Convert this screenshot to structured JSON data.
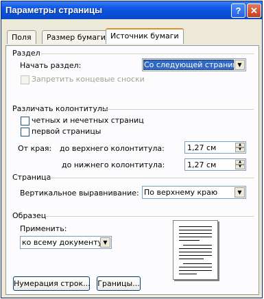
{
  "window": {
    "title": "Параметры страницы",
    "help_label": "?",
    "close_label": "✕"
  },
  "tabs": [
    {
      "label": "Поля",
      "active": false
    },
    {
      "label": "Размер бумаги",
      "active": false
    },
    {
      "label": "Источник бумаги",
      "active": true
    }
  ],
  "section": {
    "heading": "Раздел",
    "start_label": "Начать раздел:",
    "start_value": "Со следующей страницы",
    "suppress_endnotes": "Запретить концевые сноски"
  },
  "headers": {
    "heading": "Различать колонтитулы",
    "odd_even": "четных и нечетных страниц",
    "first_page": "первой страницы",
    "from_edge": "От края:",
    "header_label": "до верхнего колонтитула:",
    "header_value": "1,27 см",
    "footer_label": "до нижнего колонтитула:",
    "footer_value": "1,27 см"
  },
  "page": {
    "heading": "Страница",
    "valign_label": "Вертикальное выравнивание:",
    "valign_value": "По верхнему краю"
  },
  "preview": {
    "heading": "Образец",
    "apply_label": "Применить:",
    "apply_value": "ко всему документу"
  },
  "buttons": {
    "line_numbers": "Нумерация строк...",
    "borders": "Границы..."
  },
  "icons": {
    "dropdown": "▼",
    "spin_up": "▲",
    "spin_down": "▼"
  },
  "colors": {
    "titlebar": "#0a4fd6",
    "dialog": "#ece9d8",
    "tab_highlight": "#e68b2c",
    "selection": "#316ac5"
  }
}
